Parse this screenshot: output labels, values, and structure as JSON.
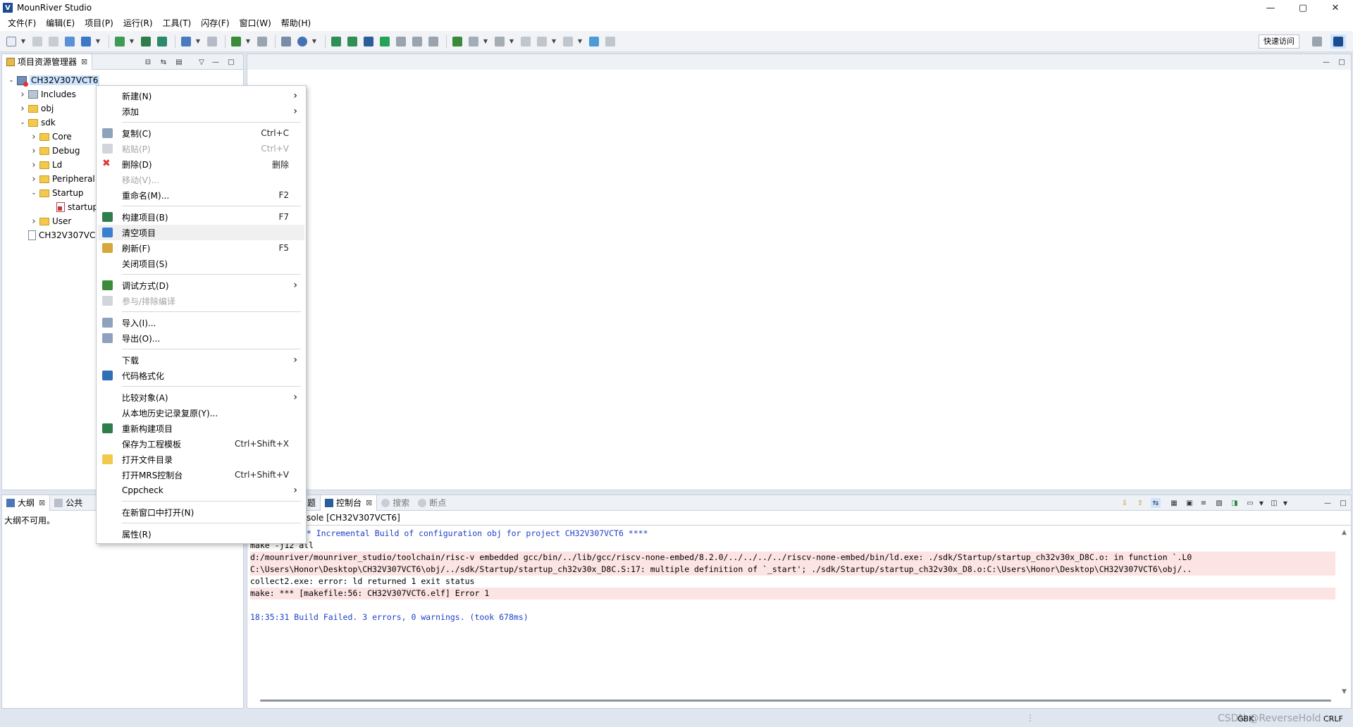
{
  "window": {
    "title": "MounRiver Studio",
    "controls": [
      "—",
      "▢",
      "✕"
    ]
  },
  "menubar": [
    "文件(F)",
    "编辑(E)",
    "项目(P)",
    "运行(R)",
    "工具(T)",
    "闪存(F)",
    "窗口(W)",
    "帮助(H)"
  ],
  "toolbar": {
    "quick_access": "快速访问"
  },
  "project_explorer": {
    "tab_label": "项目资源管理器",
    "tree": [
      {
        "label": "CH32V307VCT6",
        "type": "project",
        "twisty": "v",
        "selected": true
      },
      {
        "label": "Includes",
        "type": "includes",
        "twisty": ">"
      },
      {
        "label": "obj",
        "type": "folder",
        "twisty": ">"
      },
      {
        "label": "sdk",
        "type": "folder",
        "twisty": "v"
      },
      {
        "label": "Core",
        "type": "folder",
        "twisty": ">"
      },
      {
        "label": "Debug",
        "type": "folder",
        "twisty": ">"
      },
      {
        "label": "Ld",
        "type": "folder",
        "twisty": ">"
      },
      {
        "label": "Peripheral",
        "type": "folder",
        "twisty": ">"
      },
      {
        "label": "Startup",
        "type": "folder",
        "twisty": "v"
      },
      {
        "label": "startup_",
        "type": "asm",
        "twisty": ""
      },
      {
        "label": "User",
        "type": "folder",
        "twisty": ">"
      },
      {
        "label": "CH32V307VC",
        "type": "file",
        "twisty": ""
      }
    ]
  },
  "context_menu": {
    "items": [
      {
        "label": "新建(N)",
        "shortcut": "",
        "submenu": true,
        "disabled": false
      },
      {
        "label": "添加",
        "shortcut": "",
        "submenu": true,
        "disabled": false
      },
      {
        "label": "复制(C)",
        "shortcut": "Ctrl+C",
        "submenu": false,
        "disabled": false
      },
      {
        "label": "粘贴(P)",
        "shortcut": "Ctrl+V",
        "submenu": false,
        "disabled": true
      },
      {
        "label": "删除(D)",
        "shortcut": "删除",
        "submenu": false,
        "disabled": false
      },
      {
        "label": "移动(V)...",
        "shortcut": "",
        "submenu": false,
        "disabled": true
      },
      {
        "label": "重命名(M)...",
        "shortcut": "F2",
        "submenu": false,
        "disabled": false
      },
      {
        "label": "构建项目(B)",
        "shortcut": "F7",
        "submenu": false,
        "disabled": false
      },
      {
        "label": "清空项目",
        "shortcut": "",
        "submenu": false,
        "disabled": false,
        "hover": true
      },
      {
        "label": "刷新(F)",
        "shortcut": "F5",
        "submenu": false,
        "disabled": false
      },
      {
        "label": "关闭项目(S)",
        "shortcut": "",
        "submenu": false,
        "disabled": false
      },
      {
        "label": "调试方式(D)",
        "shortcut": "",
        "submenu": true,
        "disabled": false
      },
      {
        "label": "参与/排除编译",
        "shortcut": "",
        "submenu": false,
        "disabled": true
      },
      {
        "label": "导入(I)...",
        "shortcut": "",
        "submenu": false,
        "disabled": false
      },
      {
        "label": "导出(O)...",
        "shortcut": "",
        "submenu": false,
        "disabled": false
      },
      {
        "label": "下载",
        "shortcut": "",
        "submenu": true,
        "disabled": false
      },
      {
        "label": "代码格式化",
        "shortcut": "",
        "submenu": false,
        "disabled": false
      },
      {
        "label": "比较对象(A)",
        "shortcut": "",
        "submenu": true,
        "disabled": false
      },
      {
        "label": "从本地历史记录复原(Y)...",
        "shortcut": "",
        "submenu": false,
        "disabled": false
      },
      {
        "label": "重新构建项目",
        "shortcut": "",
        "submenu": false,
        "disabled": false
      },
      {
        "label": "保存为工程模板",
        "shortcut": "Ctrl+Shift+X",
        "submenu": false,
        "disabled": false
      },
      {
        "label": "打开文件目录",
        "shortcut": "",
        "submenu": false,
        "disabled": false
      },
      {
        "label": "打开MRS控制台",
        "shortcut": "Ctrl+Shift+V",
        "submenu": false,
        "disabled": false
      },
      {
        "label": "Cppcheck",
        "shortcut": "",
        "submenu": true,
        "disabled": false
      },
      {
        "label": "在新窗口中打开(N)",
        "shortcut": "",
        "submenu": false,
        "disabled": false
      },
      {
        "label": "属性(R)",
        "shortcut": "",
        "submenu": false,
        "disabled": false
      }
    ]
  },
  "outline": {
    "tab_label": "大纲",
    "tab2_label": "公共",
    "message": "大纲不可用。"
  },
  "console": {
    "tab_partial": "题",
    "tab_label": "控制台",
    "tab_search": "搜索",
    "tab_breakpoints": "断点",
    "header": "sole [CH32V307VCT6]",
    "lines": [
      {
        "text": "*** Incremental Build of configuration obj for project CH32V307VCT6 ****",
        "style": "blue",
        "indent": 66
      },
      {
        "text": "make -j12 all",
        "style": "normal",
        "indent": 0
      },
      {
        "text": "d:/mounriver/mounriver_studio/toolchain/risc-v embedded gcc/bin/../lib/gcc/riscv-none-embed/8.2.0/../../../../riscv-none-embed/bin/ld.exe: ./sdk/Startup/startup_ch32v30x_D8C.o: in function `.L0",
        "style": "err",
        "indent": 0
      },
      {
        "text": "C:\\Users\\Honor\\Desktop\\CH32V307VCT6\\obj/../sdk/Startup/startup_ch32v30x_D8C.S:17: multiple definition of `_start'; ./sdk/Startup/startup_ch32v30x_D8.o:C:\\Users\\Honor\\Desktop\\CH32V307VCT6\\obj/..",
        "style": "err",
        "indent": 0
      },
      {
        "text": "collect2.exe: error: ld returned 1 exit status",
        "style": "normal",
        "indent": 0
      },
      {
        "text": "make: *** [makefile:56: CH32V307VCT6.elf] Error 1",
        "style": "err",
        "indent": 0
      },
      {
        "text": "",
        "style": "normal",
        "indent": 0
      },
      {
        "text": "18:35:31 Build Failed. 3 errors, 0 warnings. (took 678ms)",
        "style": "blue",
        "indent": 0
      }
    ]
  },
  "statusbar": {
    "sep": "⋮",
    "watermark": "CSDN @ReverseHold",
    "gbk": "GBK",
    "crlf": "CRLF"
  },
  "colors": {
    "accent": "#1f3fc7",
    "error_bg": "#fde4e4",
    "selection": "#cde4ff"
  }
}
